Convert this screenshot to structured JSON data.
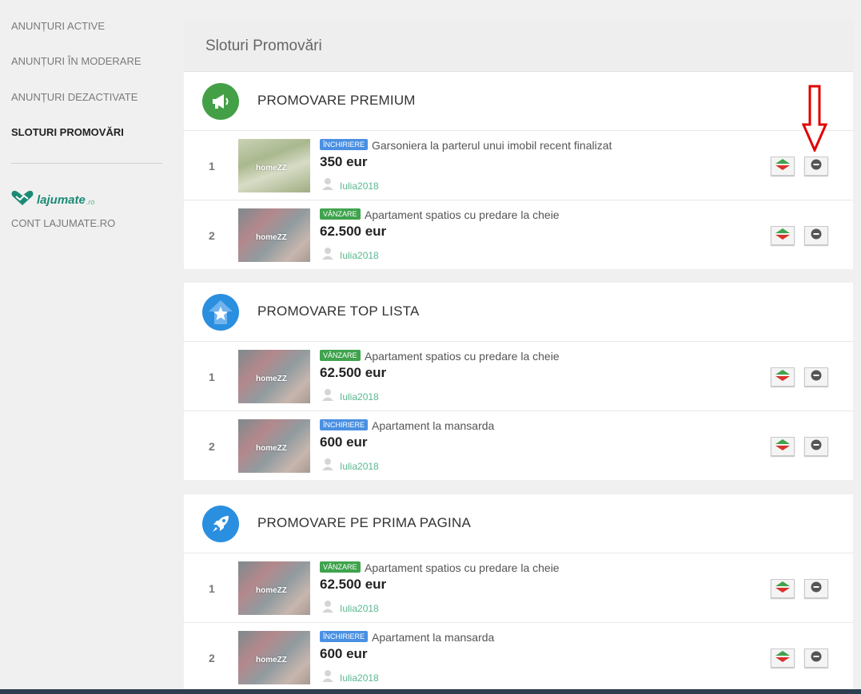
{
  "sidebar": {
    "items": [
      {
        "label": "ANUNȚURI ACTIVE"
      },
      {
        "label": "ANUNȚURI ÎN MODERARE"
      },
      {
        "label": "ANUNȚURI DEZACTIVATE"
      },
      {
        "label": "SLOTURI PROMOVĂRI",
        "active": true
      }
    ],
    "brand": {
      "name": "lajumate",
      "tld": ".ro",
      "account_label": "CONT LAJUMATE.RO"
    }
  },
  "page": {
    "title": "Sloturi Promovări"
  },
  "sections": [
    {
      "title": "PROMOVARE PREMIUM",
      "icon": "megaphone-icon",
      "color": "#43a047",
      "rows": [
        {
          "num": "1",
          "badge": "ÎNCHIRIERE",
          "badge_type": "rent",
          "title": "Garsoniera la parterul unui imobil recent finalizat",
          "price": "350 eur",
          "user": "Iulia2018",
          "thumb_text": "homeZZ"
        },
        {
          "num": "2",
          "badge": "VÂNZARE",
          "badge_type": "sale",
          "title": "Apartament spatios cu predare la cheie",
          "price": "62.500 eur",
          "user": "Iulia2018",
          "thumb_text": "homeZZ"
        }
      ]
    },
    {
      "title": "PROMOVARE TOP LISTA",
      "icon": "star-arrow-icon",
      "color": "#2b8fe0",
      "rows": [
        {
          "num": "1",
          "badge": "VÂNZARE",
          "badge_type": "sale",
          "title": "Apartament spatios cu predare la cheie",
          "price": "62.500 eur",
          "user": "Iulia2018",
          "thumb_text": "homeZZ"
        },
        {
          "num": "2",
          "badge": "ÎNCHIRIERE",
          "badge_type": "rent",
          "title": "Apartament la mansarda",
          "price": "600 eur",
          "user": "Iulia2018",
          "thumb_text": "homeZZ"
        }
      ]
    },
    {
      "title": "PROMOVARE PE PRIMA PAGINA",
      "icon": "rocket-icon",
      "color": "#2b8fe0",
      "rows": [
        {
          "num": "1",
          "badge": "VÂNZARE",
          "badge_type": "sale",
          "title": "Apartament spatios cu predare la cheie",
          "price": "62.500 eur",
          "user": "Iulia2018",
          "thumb_text": "homeZZ"
        },
        {
          "num": "2",
          "badge": "ÎNCHIRIERE",
          "badge_type": "rent",
          "title": "Apartament la mansarda",
          "price": "600 eur",
          "user": "Iulia2018",
          "thumb_text": "homeZZ"
        }
      ]
    }
  ],
  "colors": {
    "accent_green": "#5ab88f",
    "rent_badge": "#4a90e2",
    "sale_badge": "#3fa34d",
    "annotation_arrow": "#e00000"
  }
}
